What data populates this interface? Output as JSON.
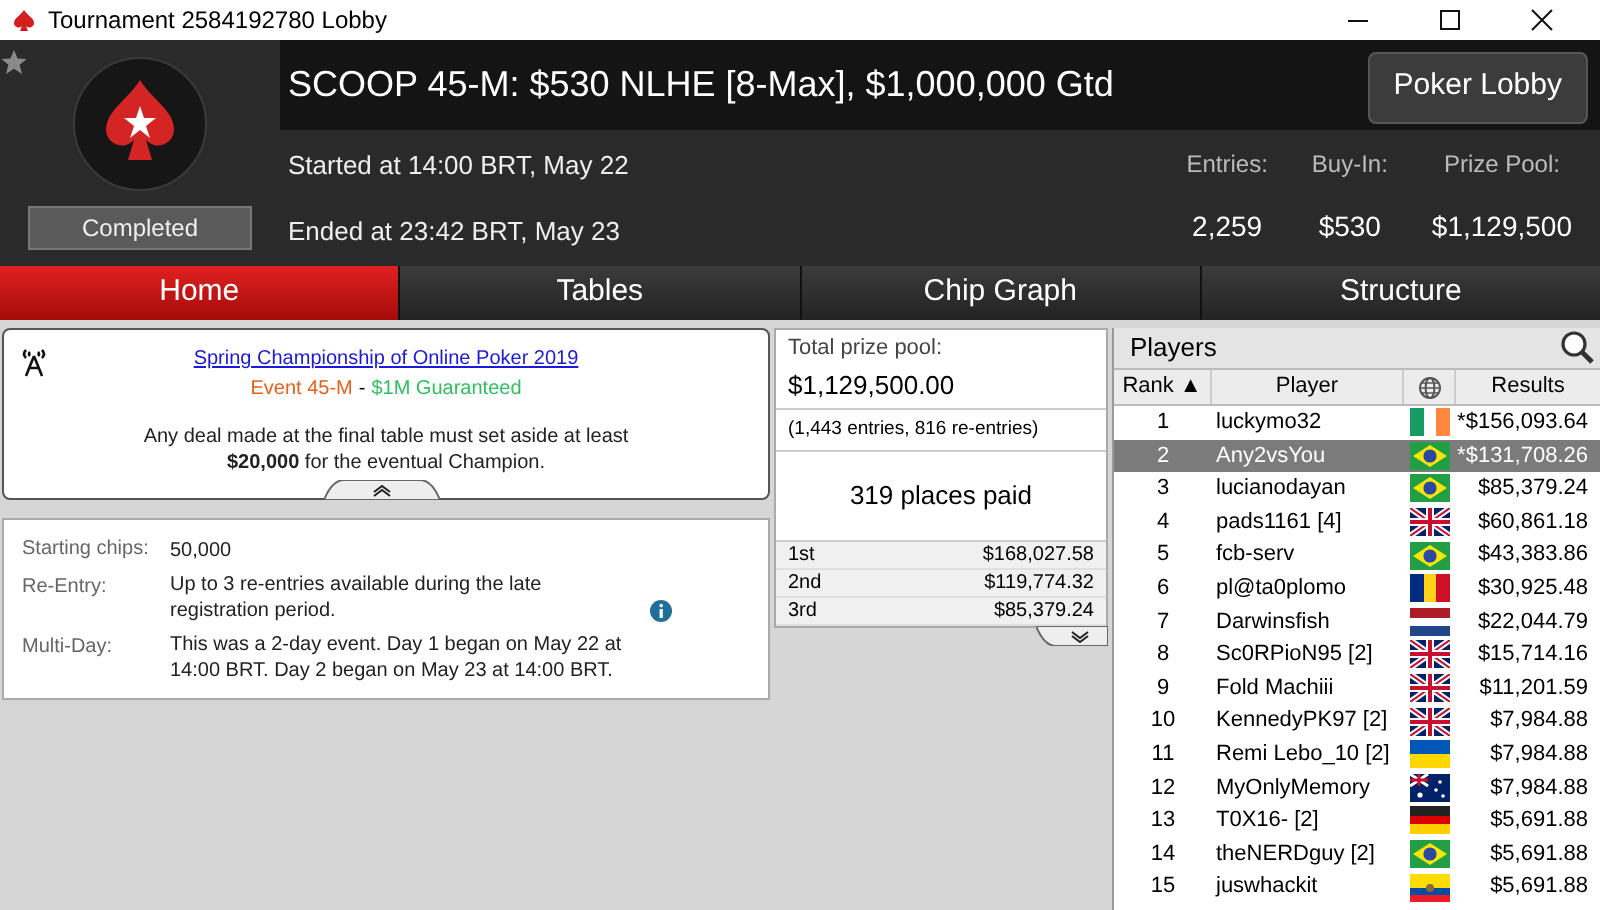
{
  "window": {
    "title": "Tournament 2584192780 Lobby"
  },
  "header": {
    "title": "SCOOP 45-M: $530 NLHE [8-Max], $1,000,000 Gtd",
    "status": "Completed",
    "started": "Started at 14:00 BRT, May 22",
    "ended": "Ended at 23:42 BRT, May 23",
    "lobby_button": "Poker Lobby",
    "stats": [
      {
        "label": "Entries:",
        "value": "2,259"
      },
      {
        "label": "Buy-In:",
        "value": "$530"
      },
      {
        "label": "Prize Pool:",
        "value": "$1,129,500"
      }
    ]
  },
  "tabs": [
    {
      "label": "Home",
      "selected": true
    },
    {
      "label": "Tables",
      "selected": false
    },
    {
      "label": "Chip Graph",
      "selected": false
    },
    {
      "label": "Structure",
      "selected": false
    }
  ],
  "notice": {
    "link": "Spring Championship of Online Poker 2019",
    "event": "Event 45-M",
    "separator": "-",
    "guarantee": "$1M Guaranteed",
    "text": "Any deal made at the final table must set aside at least **$20,000** for the eventual Champion."
  },
  "details": [
    {
      "label": "Starting chips:",
      "value": "50,000",
      "info": false
    },
    {
      "label": "Re-Entry:",
      "value": "Up to 3 re-entries available during the late registration period.",
      "info": true
    },
    {
      "label": "Multi-Day:",
      "value": "This was a 2-day event. Day 1 began on May 22 at 14:00 BRT. Day 2 began on May 23 at 14:00 BRT.",
      "info": false
    }
  ],
  "prizes": {
    "label": "Total prize pool:",
    "total": "$1,129,500.00",
    "entries": "(1,443 entries, 816 re-entries)",
    "places": "319 places paid",
    "rows": [
      {
        "place": "1st",
        "amount": "$168,027.58"
      },
      {
        "place": "2nd",
        "amount": "$119,774.32"
      },
      {
        "place": "3rd",
        "amount": "$85,379.24"
      }
    ]
  },
  "players": {
    "title": "Players",
    "columns": [
      "Rank ▲",
      "Player",
      "Results"
    ],
    "rows": [
      {
        "rank": "1",
        "player": "luckymo32",
        "kind": "ie",
        "result": "*$156,093.64",
        "selected": false
      },
      {
        "rank": "2",
        "player": "Any2vsYou",
        "kind": "br",
        "result": "*$131,708.26",
        "selected": true
      },
      {
        "rank": "3",
        "player": "lucianodayan",
        "kind": "br",
        "result": "$85,379.24",
        "selected": false
      },
      {
        "rank": "4",
        "player": "pads1161 [4]",
        "kind": "gb",
        "result": "$60,861.18",
        "selected": false
      },
      {
        "rank": "5",
        "player": "fcb-serv",
        "kind": "br",
        "result": "$43,383.86",
        "selected": false
      },
      {
        "rank": "6",
        "player": "pl@ta0plomo",
        "kind": "ro",
        "result": "$30,925.48",
        "selected": false
      },
      {
        "rank": "7",
        "player": "Darwinsfish",
        "kind": "nl",
        "result": "$22,044.79",
        "selected": false
      },
      {
        "rank": "8",
        "player": "Sc0RPioN95 [2]",
        "kind": "gb",
        "result": "$15,714.16",
        "selected": false
      },
      {
        "rank": "9",
        "player": "Fold Machiii",
        "kind": "gb",
        "result": "$11,201.59",
        "selected": false
      },
      {
        "rank": "10",
        "player": "KennedyPK97 [2]",
        "kind": "gb",
        "result": "$7,984.88",
        "selected": false
      },
      {
        "rank": "11",
        "player": "Remi Lebo_10 [2]",
        "kind": "ua",
        "result": "$7,984.88",
        "selected": false
      },
      {
        "rank": "12",
        "player": "MyOnlyMemory",
        "kind": "au",
        "result": "$7,984.88",
        "selected": false
      },
      {
        "rank": "13",
        "player": "T0X16- [2]",
        "kind": "de",
        "result": "$5,691.88",
        "selected": false
      },
      {
        "rank": "14",
        "player": "theNERDguy [2]",
        "kind": "br",
        "result": "$5,691.88",
        "selected": false
      },
      {
        "rank": "15",
        "player": "juswhackit",
        "kind": "ec",
        "result": "$5,691.88",
        "selected": false
      }
    ]
  }
}
